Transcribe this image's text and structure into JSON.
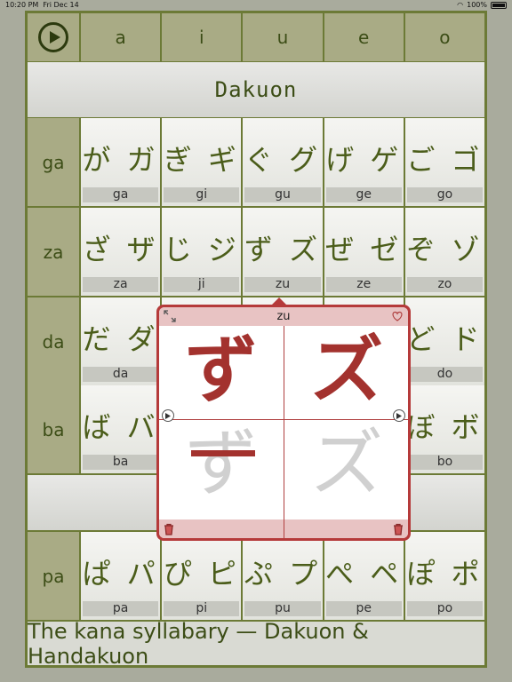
{
  "status": {
    "time": "10:20 PM",
    "date": "Fri Dec 14",
    "battery": "100%"
  },
  "header": {
    "vowels": [
      "a",
      "i",
      "u",
      "e",
      "o"
    ]
  },
  "banner_top": "Dakuon",
  "rows": [
    {
      "label": "ga",
      "cells": [
        {
          "kana": "が ガ",
          "roma": "ga"
        },
        {
          "kana": "ぎ ギ",
          "roma": "gi"
        },
        {
          "kana": "ぐ グ",
          "roma": "gu"
        },
        {
          "kana": "げ ゲ",
          "roma": "ge"
        },
        {
          "kana": "ご ゴ",
          "roma": "go"
        }
      ]
    },
    {
      "label": "za",
      "cells": [
        {
          "kana": "ざ ザ",
          "roma": "za"
        },
        {
          "kana": "じ ジ",
          "roma": "ji"
        },
        {
          "kana": "ず ズ",
          "roma": "zu"
        },
        {
          "kana": "ぜ ゼ",
          "roma": "ze"
        },
        {
          "kana": "ぞ ゾ",
          "roma": "zo"
        }
      ]
    },
    {
      "label": "da",
      "cells": [
        {
          "kana": "だ ダ",
          "roma": "da"
        },
        {
          "kana": "",
          "roma": ""
        },
        {
          "kana": "",
          "roma": ""
        },
        {
          "kana": "",
          "roma": ""
        },
        {
          "kana": "ど ド",
          "roma": "do"
        }
      ]
    },
    {
      "label": "ba",
      "cells": [
        {
          "kana": "ば バ",
          "roma": "ba"
        },
        {
          "kana": "",
          "roma": ""
        },
        {
          "kana": "",
          "roma": ""
        },
        {
          "kana": "",
          "roma": ""
        },
        {
          "kana": "ぼ ボ",
          "roma": "bo"
        }
      ]
    },
    {
      "label": "pa",
      "cells": [
        {
          "kana": "ぱ パ",
          "roma": "pa"
        },
        {
          "kana": "ぴ ピ",
          "roma": "pi"
        },
        {
          "kana": "ぷ プ",
          "roma": "pu"
        },
        {
          "kana": "ぺ ペ",
          "roma": "pe"
        },
        {
          "kana": "ぽ ポ",
          "roma": "po"
        }
      ]
    }
  ],
  "footer": "The kana syllabary — Dakuon & Handakuon",
  "popup": {
    "title": "zu",
    "hiragana": "ず",
    "katakana": "ズ"
  }
}
